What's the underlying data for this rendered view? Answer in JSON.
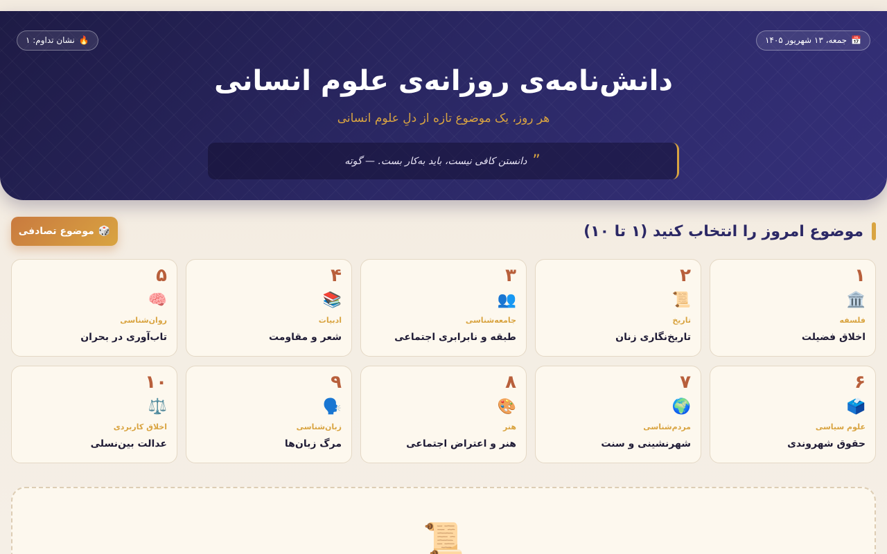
{
  "header": {
    "date_icon": "calendar-icon",
    "date_text": "جمعه، ۱۳ شهریور ۱۴۰۵",
    "streak_icon": "fire-icon",
    "streak_text": "نشان تداوم: ۱",
    "title": "دانش‌نامه‌ی روزانه‌ی علوم انسانی",
    "subtitle": "هر روز، یک موضوع تازه از دلِ علوم انسانی",
    "quote": "دانستن کافی نیست، باید به‌کار بست. — گوته"
  },
  "picker": {
    "title": "موضوع امروز را انتخاب کنید (۱ تا ۱۰)",
    "random_button": "موضوع تصادفی",
    "random_icon": "dice-icon"
  },
  "topics": [
    {
      "num": "۱",
      "icon": "🏛️",
      "icon_name": "classical-building-icon",
      "category": "فلسفه",
      "title": "اخلاق فضیلت"
    },
    {
      "num": "۲",
      "icon": "📜",
      "icon_name": "scroll-icon",
      "category": "تاریخ",
      "title": "تاریخ‌نگاری زنان"
    },
    {
      "num": "۳",
      "icon": "👥",
      "icon_name": "people-icon",
      "category": "جامعه‌شناسی",
      "title": "طبقه و نابرابری اجتماعی"
    },
    {
      "num": "۴",
      "icon": "📚",
      "icon_name": "books-icon",
      "category": "ادبیات",
      "title": "شعر و مقاومت"
    },
    {
      "num": "۵",
      "icon": "🧠",
      "icon_name": "brain-icon",
      "category": "روان‌شناسی",
      "title": "تاب‌آوری در بحران"
    },
    {
      "num": "۶",
      "icon": "🗳️",
      "icon_name": "ballot-box-icon",
      "category": "علوم سیاسی",
      "title": "حقوق شهروندی"
    },
    {
      "num": "۷",
      "icon": "🌍",
      "icon_name": "globe-icon",
      "category": "مردم‌شناسی",
      "title": "شهرنشینی و سنت"
    },
    {
      "num": "۸",
      "icon": "🎨",
      "icon_name": "palette-icon",
      "category": "هنر",
      "title": "هنر و اعتراض اجتماعی"
    },
    {
      "num": "۹",
      "icon": "🗣️",
      "icon_name": "speaking-head-icon",
      "category": "زبان‌شناسی",
      "title": "مرگ زبان‌ها"
    },
    {
      "num": "۱۰",
      "icon": "⚖️",
      "icon_name": "scales-icon",
      "category": "اخلاق کاربردی",
      "title": "عدالت بین‌نسلی"
    }
  ],
  "detail": {
    "placeholder_icon": "📜",
    "placeholder_icon_name": "scroll-icon"
  },
  "colors": {
    "accent": "#d9a441",
    "number": "#b85f3b",
    "hero": "#2b2865"
  }
}
